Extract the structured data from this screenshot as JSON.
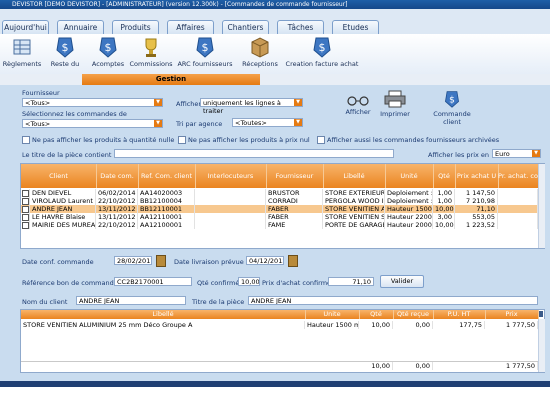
{
  "window": {
    "title": "DEVISTOR [DEMO DEVISTOR] - [ADMINISTRATEUR] (version 12.300k) - [Commandes de commande fournisseur]"
  },
  "tabs": [
    {
      "label": "Aujourd'hui"
    },
    {
      "label": "Annuaire"
    },
    {
      "label": "Produits"
    },
    {
      "label": "Affaires"
    },
    {
      "label": "Chantiers"
    },
    {
      "label": "Tâches"
    },
    {
      "label": "Etudes"
    }
  ],
  "toolbar": [
    {
      "label": "Règlements"
    },
    {
      "label": "Reste du"
    },
    {
      "label": "Acomptes"
    },
    {
      "label": "Commissions"
    },
    {
      "label": "ARC fournisseurs"
    },
    {
      "label": "Réceptions"
    },
    {
      "label": "Creation facture achat"
    }
  ],
  "section_title": "Gestion",
  "filters": {
    "fournisseur_label": "Fournisseur",
    "fournisseur_value": "<Tous>",
    "commandes_label": "Sélectionnez les commandes de",
    "commandes_value": "<Tous>",
    "afficher_label": "Afficher",
    "afficher_value": "uniquement les lignes à traiter",
    "tri_label": "Tri par agence",
    "tri_value": "<Toutes>",
    "opt1": "Ne pas afficher les produits à quantité nulle",
    "opt2": "Ne pas afficher les produits à prix nul",
    "opt3": "Afficher aussi les commandes fournisseurs archivées",
    "titre_label": "Le titre de la pièce contient",
    "titre_value": "",
    "prix_label": "Afficher les prix en",
    "prix_value": "Euro"
  },
  "actions": {
    "afficher": "Afficher",
    "imprimer": "Imprimer",
    "commande_client": "Commande client"
  },
  "grid": {
    "headers": [
      "Client",
      "Date com.",
      "Ref. Com. client",
      "Interlocuteurs",
      "Fournisseur",
      "Libellé",
      "Unité",
      "Qté",
      "Prix achat U",
      "Pr. achat. co"
    ],
    "rows": [
      [
        "DEN DIEVEL",
        "06/02/2014",
        "AA14020003",
        "",
        "BRUSTOR",
        "STORE EXTERIEUR I",
        "Deploiement :",
        "1,00",
        "1 147,50",
        ""
      ],
      [
        "VIROLAUD Laurent",
        "22/10/2012",
        "BB12100004",
        "",
        "CORRADI",
        "PERGOLA WOOD IN",
        "Deploiement :",
        "1,00",
        "7 210,98",
        ""
      ],
      [
        "ANDRE JEAN",
        "13/11/2012",
        "BB12110001",
        "",
        "FABER",
        "STORE VENITIEN AI",
        "Hauteur 1500",
        "10,00",
        "71,10",
        ""
      ],
      [
        "LE HAVRE Blaise",
        "13/11/2012",
        "AA12110001",
        "",
        "FABER",
        "STORE VENITIEN SK",
        "Hauteur 2200",
        "3,00",
        "553,05",
        ""
      ],
      [
        "MAIRIE DES MUREAU",
        "22/10/2012",
        "AA12100001",
        "",
        "FAME",
        "PORTE DE GARAGE",
        "Hauteur 2000",
        "10,00",
        "1 223,52",
        ""
      ]
    ]
  },
  "details": {
    "date_conf_label": "Date conf. commande",
    "date_conf_value": "28/02/2017",
    "date_livraison_label": "Date livraison prévue",
    "date_livraison_value": "04/12/2012",
    "ref_label": "Référence bon de commande",
    "ref_value": "CC2B2170001",
    "qte_label": "Qté confirmée",
    "qte_value": "10,00",
    "prix_label": "Prix d'achat confirmé",
    "prix_value": "71,10",
    "valider": "Valider",
    "nom_label": "Nom du client",
    "nom_value": "ANDRE JEAN",
    "titre_label": "Titre de la pièce",
    "titre_value": "ANDRE JEAN"
  },
  "lines": {
    "headers": [
      "Libellé",
      "Unite",
      "Qté prévue",
      "Qté reçue",
      "P.U. HT",
      "Prix"
    ],
    "rows": [
      [
        "STORE VENITIEN ALUMINIUM 25 mm Déco Groupe A",
        "Hauteur 1500 mr",
        "10,00",
        "0,00",
        "177,75",
        "1 777,50"
      ]
    ],
    "totals": [
      "10,00",
      "0,00",
      "1 777,50"
    ]
  }
}
